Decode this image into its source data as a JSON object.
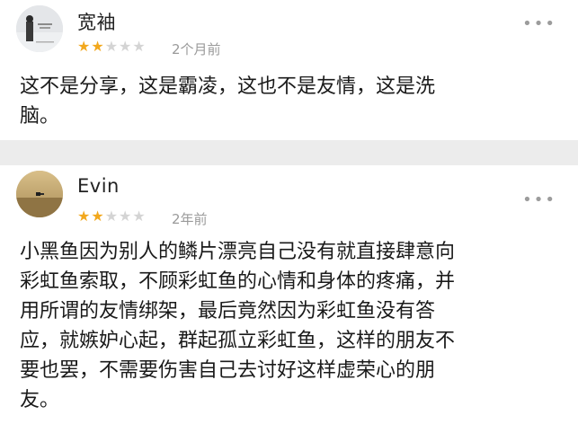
{
  "reviews": [
    {
      "name": "宽袖",
      "rating": 2,
      "time": "2个月前",
      "content": "这不是分享，这是霸凌，这也不是友情，这是洗\n脑。"
    },
    {
      "name": "Evin",
      "rating": 2,
      "time": "2年前",
      "content": "小黑鱼因为别人的鳞片漂亮自己没有就直接肆意向\n彩虹鱼索取，不顾彩虹鱼的心情和身体的疼痛，并\n用所谓的友情绑架，最后竟然因为彩虹鱼没有答\n应，就嫉妒心起，群起孤立彩虹鱼，这样的朋友不\n要也罢，不需要伤害自己去讨好这样虚荣心的朋\n友。"
    }
  ],
  "icons": {
    "more": "more-dots-icon",
    "star": "star-icon"
  },
  "colors": {
    "star_active": "#f2a81d",
    "star_inactive": "#d4d4d4",
    "time": "#9a9a9a"
  }
}
